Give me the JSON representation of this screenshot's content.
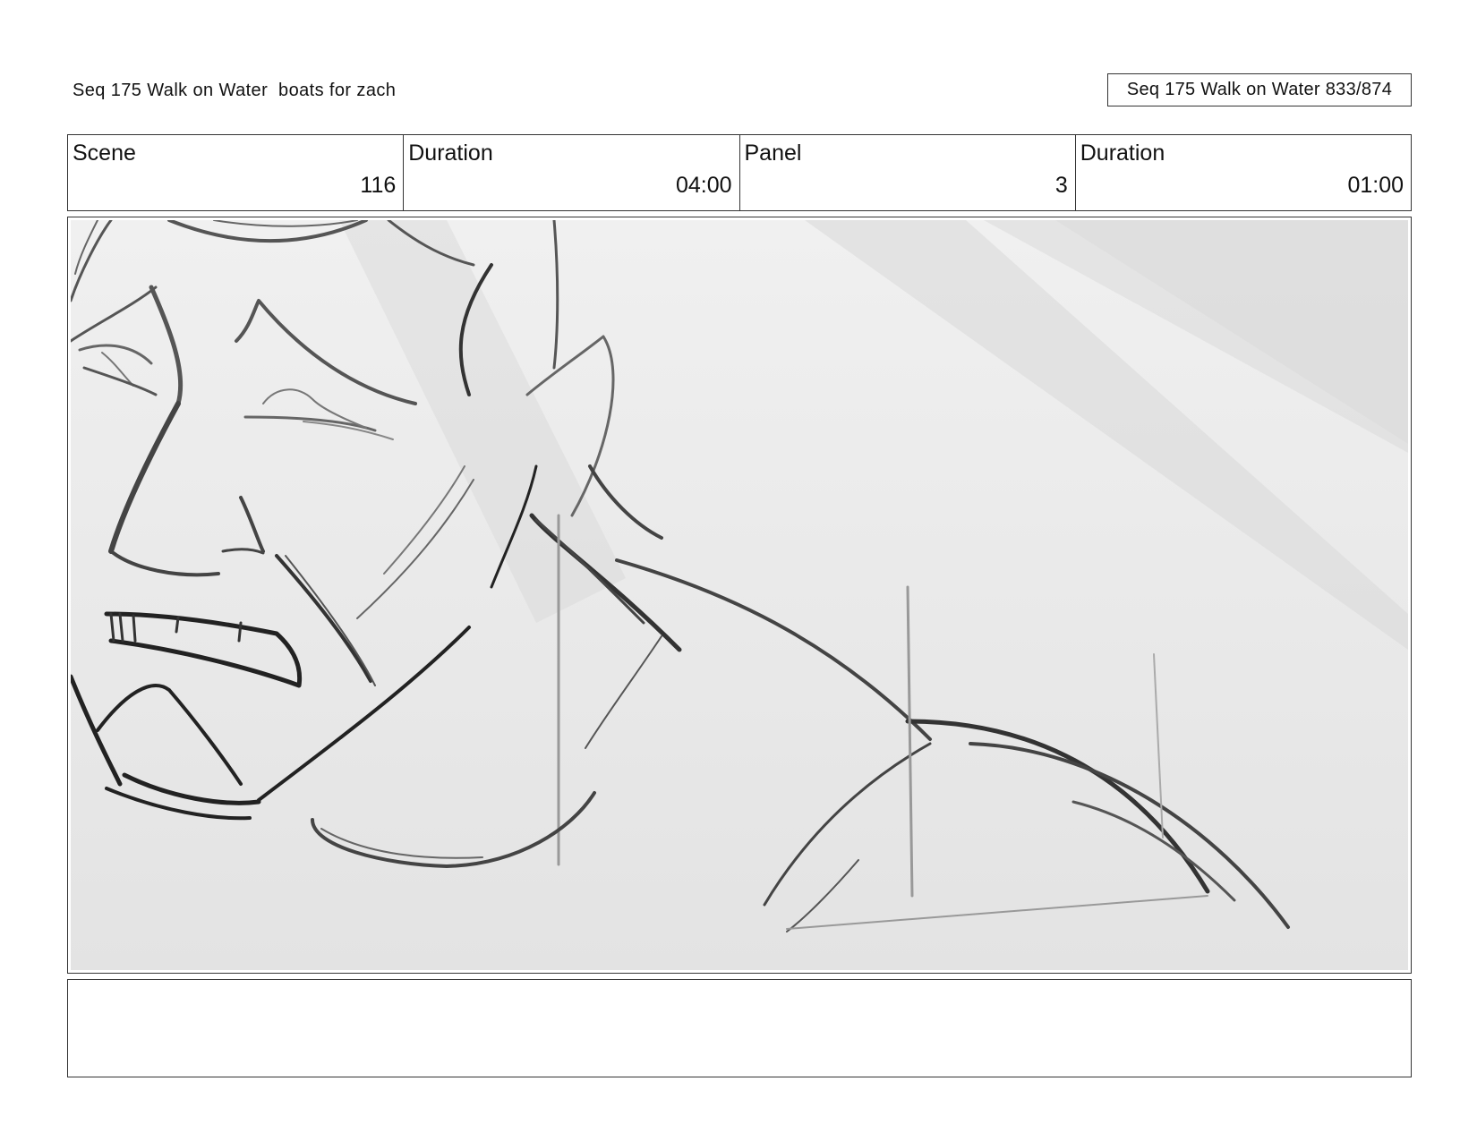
{
  "header": {
    "left_text": "Seq 175 Walk on Water  boats for zach",
    "right_text": "Seq 175 Walk on Water 833/874"
  },
  "info": {
    "scene_label": "Scene",
    "scene_value": "116",
    "duration_label": "Duration",
    "duration_value": "04:00",
    "panel_label": "Panel",
    "panel_value": "3",
    "panel_duration_label": "Duration",
    "panel_duration_value": "01:00"
  },
  "panel": {
    "image": "storyboard-sketch-close-up-angry-face-and-shoulder"
  },
  "notes": {
    "text": ""
  }
}
